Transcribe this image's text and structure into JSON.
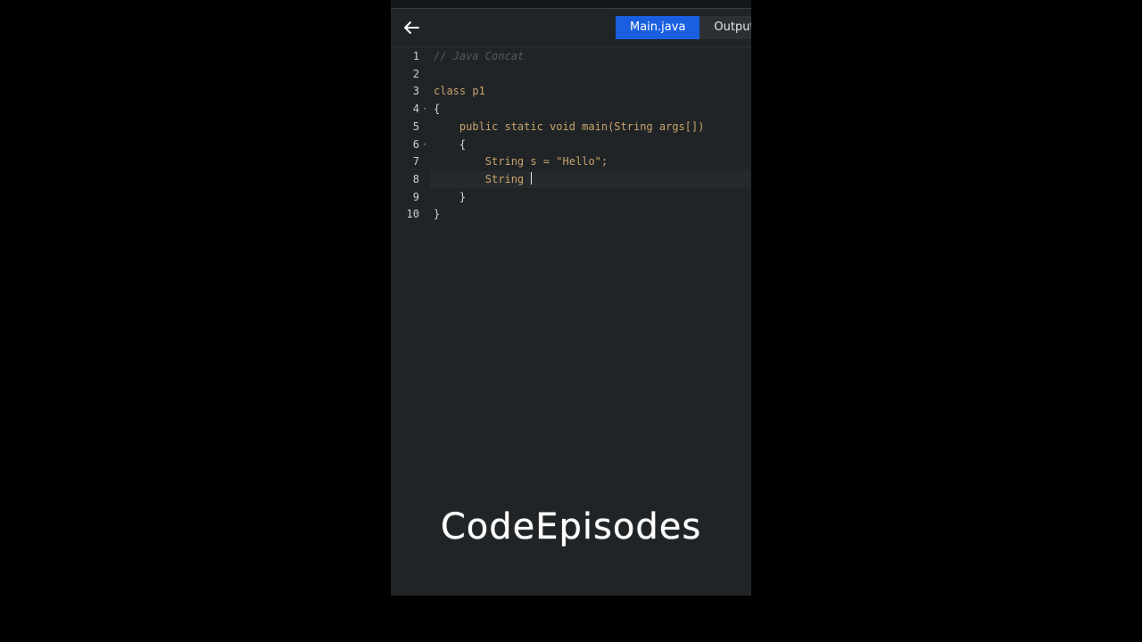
{
  "toolbar": {
    "back_icon": "arrow-left-icon",
    "tabs": [
      {
        "label": "Main.java",
        "active": true
      },
      {
        "label": "Output",
        "active": false
      }
    ],
    "accent": "#1a5fe0"
  },
  "editor": {
    "current_line": 8,
    "lines": [
      {
        "n": "1",
        "text": "// Java Concat"
      },
      {
        "n": "2",
        "text": ""
      },
      {
        "n": "3",
        "text": "class p1"
      },
      {
        "n": "4",
        "text": "{"
      },
      {
        "n": "5",
        "text": "    public static void main(String args[])"
      },
      {
        "n": "6",
        "text": "    {"
      },
      {
        "n": "7",
        "text": "        String s = \"Hello\";"
      },
      {
        "n": "8",
        "text": "        String "
      },
      {
        "n": "9",
        "text": "    }"
      },
      {
        "n": "10",
        "text": "}"
      }
    ]
  },
  "watermark": {
    "text": "CodeEpisodes"
  }
}
